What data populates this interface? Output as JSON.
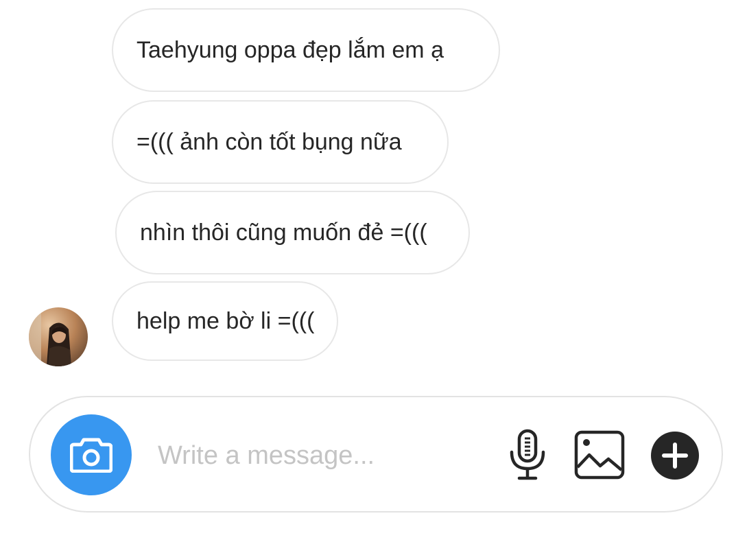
{
  "conversation": {
    "messages": [
      {
        "text": "Taehyung oppa đẹp lắm em ạ"
      },
      {
        "text": "=((( ảnh còn tốt bụng nữa"
      },
      {
        "text": "nhìn thôi cũng muốn đẻ =((("
      },
      {
        "text": "help me bờ li =((("
      }
    ],
    "avatar": {
      "description": "profile-photo"
    }
  },
  "composer": {
    "placeholder": "Write a message...",
    "value": "",
    "icons": {
      "camera": "camera-icon",
      "microphone": "microphone-icon",
      "gallery": "gallery-icon",
      "more": "plus-icon"
    },
    "colors": {
      "camera_button": "#3897f0",
      "plus_button": "#262626"
    }
  }
}
